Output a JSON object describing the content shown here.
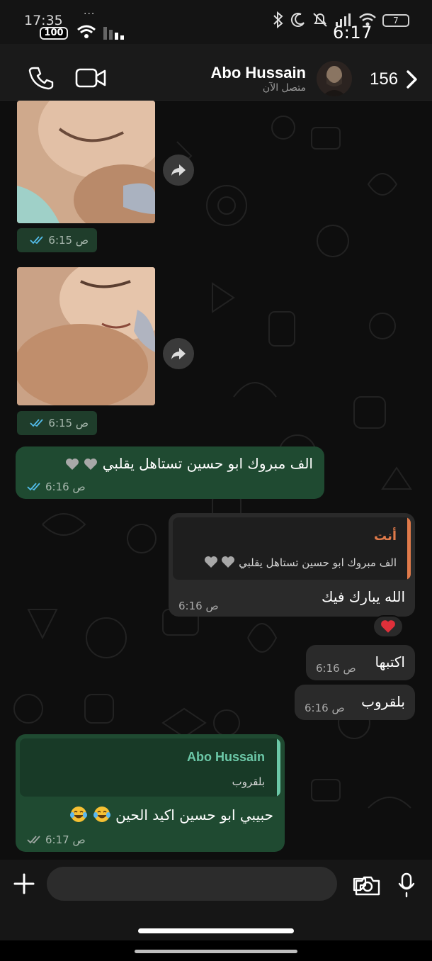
{
  "status_bar": {
    "time_small": "17:35",
    "battery_left": "100",
    "time_big": "6:17",
    "battery_right": "7"
  },
  "header": {
    "contact_name": "Abo Hussain",
    "contact_status": "متصل الآن",
    "back_count": "156"
  },
  "messages": [
    {
      "type": "image",
      "direction": "in",
      "time": "6:15 ص",
      "ticks": "read"
    },
    {
      "type": "image",
      "direction": "in",
      "time": "6:15 ص",
      "ticks": "read"
    },
    {
      "type": "text",
      "direction": "in",
      "text": "الف مبروك ابو حسين تستاهل يقلبي",
      "emoji": [
        "grey-heart",
        "grey-heart"
      ],
      "time": "6:16 ص",
      "ticks": "read"
    },
    {
      "type": "reply",
      "direction": "out",
      "quote": {
        "author": "أنت",
        "text": "الف مبروك ابو حسين تستاهل يقلبي",
        "emoji": [
          "grey-heart",
          "grey-heart"
        ]
      },
      "text": "الله يبارك فيك",
      "time": "6:16 ص",
      "reaction": "red-heart"
    },
    {
      "type": "text",
      "direction": "out",
      "text": "اكتبها",
      "time": "6:16 ص"
    },
    {
      "type": "text",
      "direction": "out",
      "text": "بلقروب",
      "time": "6:16 ص"
    },
    {
      "type": "reply",
      "direction": "in",
      "quote": {
        "author": "Abo Hussain",
        "text": "بلقروب"
      },
      "text": "حبيبي ابو حسين اكيد الحين",
      "emoji": [
        "tears-of-joy",
        "tears-of-joy"
      ],
      "time": "6:17 ص",
      "ticks": "delivered"
    }
  ],
  "composer": {
    "placeholder": "",
    "icons": [
      "plus-icon",
      "sticker-icon",
      "camera-icon",
      "microphone-icon"
    ]
  },
  "colors": {
    "incoming_bubble": "#1f4a31",
    "outgoing_bubble": "#2a2a2a",
    "read_ticks": "#53bdeb",
    "own_quote_accent": "#e07a4a",
    "contact_quote_accent": "#6cc8a8"
  }
}
